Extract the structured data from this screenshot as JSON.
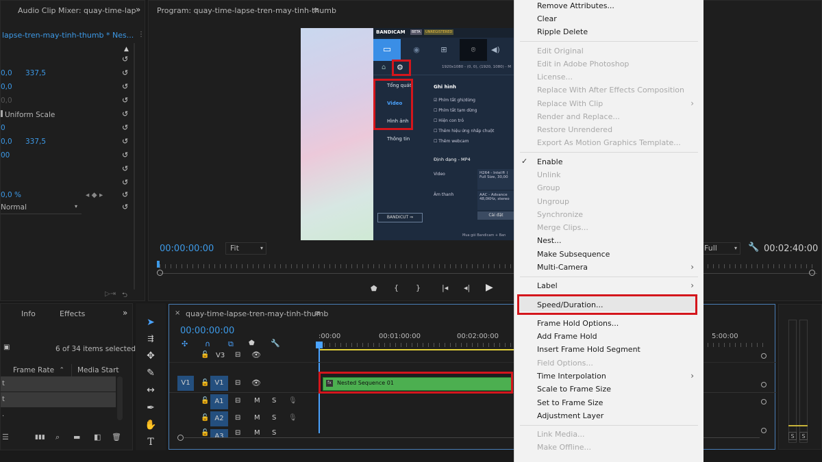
{
  "left_top_panel": {
    "tab_title": "Audio Clip Mixer: quay-time-lap",
    "sequence_title": "lapse-tren-may-tinh-thumb * Nes...",
    "rows": [
      {
        "a": "0,0",
        "b": "337,5"
      },
      {
        "a": "0,0",
        "b": ""
      },
      {
        "a": "0,0",
        "b": ""
      },
      {
        "a": "Uniform Scale",
        "b": ""
      },
      {
        "a": "0",
        "b": ""
      },
      {
        "a": "0,0",
        "b": "337,5"
      },
      {
        "a": "00",
        "b": ""
      },
      {
        "a": "",
        "b": ""
      },
      {
        "a": "0,0 %",
        "b": ""
      },
      {
        "a": "Normal",
        "b": ""
      }
    ]
  },
  "program_monitor": {
    "title": "Program: quay-time-lapse-tren-may-tinh-thumb",
    "timecode": "00:00:00:00",
    "fit": "Fit",
    "quality": "Full",
    "duration": "00:02:40:00"
  },
  "bandicam": {
    "brand": "BANDICAM",
    "beta": "BETA",
    "unregistered": "UNREGISTERED",
    "resolution": "1920x1080 - (0, 0), (1920, 1080) - M",
    "side_items": [
      "Tổng quát",
      "Video",
      "Hình ảnh",
      "Thông tin"
    ],
    "section_title": "Ghi hình",
    "options": [
      "Phím tắt ghi/dừng",
      "Phím tắt tạm dừng",
      "Hiện con trỏ",
      "Thêm hiệu ứng nhấp chuột",
      "Thêm webcam"
    ],
    "format_label": "Định dạng",
    "format_value": "MP4",
    "video_label": "Video",
    "video_value_1": "H264 - Intel® (",
    "video_value_2": "Full Size, 30,00",
    "audio_label": "Âm thanh",
    "audio_value_1": "AAC - Advance",
    "audio_value_2": "48,0KHz, stereo",
    "settings_button": "Cài đặt",
    "bandicut": "BANDICUT",
    "buy": "Mua gói Bandicam + Ban"
  },
  "project_panel": {
    "tabs": [
      "Info",
      "Effects"
    ],
    "items_selected": "6 of 34 items selected",
    "col_frame_rate": "Frame Rate",
    "col_media_start": "Media Start",
    "rows": [
      "t",
      "t",
      "."
    ]
  },
  "timeline": {
    "title": "quay-time-lapse-tren-may-tinh-thumb",
    "timecode": "00:00:00:00",
    "ruler": [
      ":00:00",
      "00:01:00:00",
      "00:02:00:00",
      "5:00:00"
    ],
    "tracks": [
      {
        "label": "V3",
        "src": ""
      },
      {
        "label": "V1",
        "src": "V1"
      },
      {
        "label": "A1",
        "src": ""
      },
      {
        "label": "A2",
        "src": ""
      },
      {
        "label": "A3",
        "src": ""
      }
    ],
    "clip_name": "Nested Sequence 01",
    "m": "M",
    "s": "S"
  },
  "meter": {
    "s1": "S",
    "s2": "S"
  },
  "context_menu": {
    "items": [
      {
        "label": "Remove Attributes...",
        "disabled": false
      },
      {
        "label": "Clear",
        "disabled": false
      },
      {
        "label": "Ripple Delete",
        "disabled": false
      },
      {
        "label": "Edit Original",
        "disabled": true
      },
      {
        "label": "Edit in Adobe Photoshop",
        "disabled": true
      },
      {
        "label": "License...",
        "disabled": true
      },
      {
        "label": "Replace With After Effects Composition",
        "disabled": true
      },
      {
        "label": "Replace With Clip",
        "disabled": true
      },
      {
        "label": "Render and Replace...",
        "disabled": true
      },
      {
        "label": "Restore Unrendered",
        "disabled": true
      },
      {
        "label": "Export As Motion Graphics Template...",
        "disabled": true
      },
      {
        "label": "Enable",
        "disabled": false
      },
      {
        "label": "Unlink",
        "disabled": true
      },
      {
        "label": "Group",
        "disabled": true
      },
      {
        "label": "Ungroup",
        "disabled": true
      },
      {
        "label": "Synchronize",
        "disabled": true
      },
      {
        "label": "Merge Clips...",
        "disabled": true
      },
      {
        "label": "Nest...",
        "disabled": false
      },
      {
        "label": "Make Subsequence",
        "disabled": false
      },
      {
        "label": "Multi-Camera",
        "disabled": false
      },
      {
        "label": "Label",
        "disabled": false
      },
      {
        "label": "Speed/Duration...",
        "disabled": false
      },
      {
        "label": "Frame Hold Options...",
        "disabled": false
      },
      {
        "label": "Add Frame Hold",
        "disabled": false
      },
      {
        "label": "Insert Frame Hold Segment",
        "disabled": false
      },
      {
        "label": "Field Options...",
        "disabled": true
      },
      {
        "label": "Time Interpolation",
        "disabled": false
      },
      {
        "label": "Scale to Frame Size",
        "disabled": false
      },
      {
        "label": "Set to Frame Size",
        "disabled": false
      },
      {
        "label": "Adjustment Layer",
        "disabled": false
      },
      {
        "label": "Link Media...",
        "disabled": true
      },
      {
        "label": "Make Offline...",
        "disabled": true
      }
    ]
  }
}
